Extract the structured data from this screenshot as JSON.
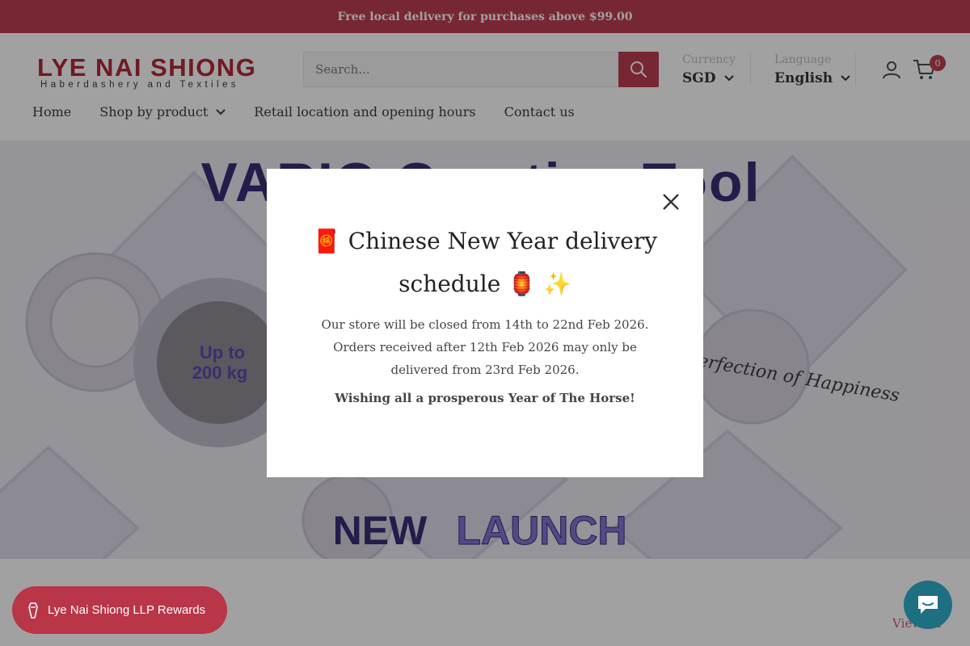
{
  "announcement": {
    "text": "Free local delivery for purchases above $99.00"
  },
  "brand": {
    "name": "LYE NAI SHIONG",
    "tagline": "Haberdashery and Textiles"
  },
  "search": {
    "placeholder": "Search...",
    "icon": "search-icon"
  },
  "currency": {
    "label": "Currency",
    "value": "SGD"
  },
  "language": {
    "label": "Language",
    "value": "English"
  },
  "cart": {
    "count": "0"
  },
  "nav": {
    "items": [
      {
        "label": "Home"
      },
      {
        "label": "Shop by product"
      },
      {
        "label": "Retail location and opening hours"
      },
      {
        "label": "Contact us"
      }
    ]
  },
  "banner": {
    "headline": "VARIO Creative Tool",
    "badge_line1": "Up to",
    "badge_line2": "200 kg",
    "script_text": "Perfection of Happiness",
    "new_word": "NEW",
    "launch_word": "LAUNCH"
  },
  "modal": {
    "title_prefix_emoji": "🧧",
    "title_line1": "Chinese New Year delivery",
    "title_line2": "schedule",
    "title_emojis": "🏮 ✨",
    "body_line1": "Our store will be closed from 14th to 22nd Feb 2026.",
    "body_line2": "Orders received after 12th Feb 2026 may only be",
    "body_line3": "delivered from 23rd Feb 2026.",
    "wish": "Wishing all a prosperous Year of The Horse!"
  },
  "rewards": {
    "label": "Lye Nai Shiong LLP Rewards"
  },
  "section": {
    "view_all": "View all"
  },
  "colors": {
    "accent": "#b93548",
    "chat": "#1f6f82",
    "banner_bg": "#eceaf2",
    "brand_red": "#b01e2a"
  }
}
